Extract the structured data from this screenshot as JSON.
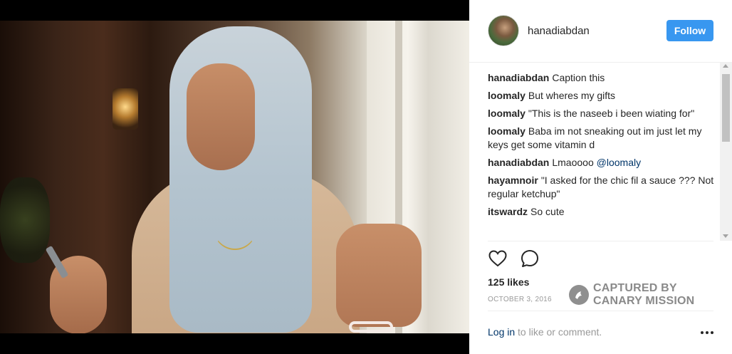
{
  "post": {
    "username": "hanadiabdan",
    "follow_label": "Follow",
    "likes": "125 likes",
    "date": "OCTOBER 3, 2016",
    "login_link": "Log in",
    "login_rest": " to like or comment."
  },
  "comments": [
    {
      "author": "hanadiabdan",
      "text": "Caption this"
    },
    {
      "author": "loomaly",
      "text": "But wheres my gifts"
    },
    {
      "author": "loomaly",
      "text": "\"This is the naseeb i been wiating for\""
    },
    {
      "author": "loomaly",
      "text": "Baba im not sneaking out im just let my keys get some vitamin d"
    },
    {
      "author": "hanadiabdan",
      "text": "Lmaoooo ",
      "mention": "@loomaly"
    },
    {
      "author": "hayamnoir",
      "text": "\"I asked for the chic fil a sauce ??? Not regular ketchup\""
    },
    {
      "author": "itswardz",
      "text": "So cute"
    }
  ],
  "watermark": {
    "line1": "CAPTURED BY",
    "line2": "CANARY MISSION"
  },
  "icons": [
    "heart-icon",
    "comment-bubble-icon",
    "more-options-icon",
    "canary-mission-logo"
  ],
  "colors": {
    "follow_button": "#3897f0",
    "link": "#003569"
  }
}
